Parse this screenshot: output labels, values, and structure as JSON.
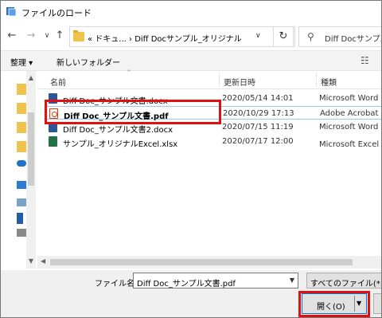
{
  "window": {
    "title": "ファイルのロード"
  },
  "nav": {
    "address_crumbs": "« ドキュ...  ›  Diff Docサンプル_オリジナル",
    "search_placeholder": "Diff Docサンプル"
  },
  "toolbar": {
    "organize": "整理 ▾",
    "new_folder": "新しいフォルダー"
  },
  "columns": {
    "name": "名前",
    "date": "更新日時",
    "type": "種類"
  },
  "files": [
    {
      "name": "Diff Doc_サンプル文書.docx",
      "date": "2020/05/14 14:01",
      "type": "Microsoft Word ...",
      "icon": "word-icon"
    },
    {
      "name": "Diff Doc_サンプル文書.pdf",
      "date": "2020/10/29 17:13",
      "type": "Adobe Acrobat D",
      "icon": "pdf-icon"
    },
    {
      "name": "Diff Doc_サンプル文書2.docx",
      "date": "2020/07/15 11:19",
      "type": "Microsoft Word ...",
      "icon": "word-icon"
    },
    {
      "name": "サンプル_オリジナルExcel.xlsx",
      "date": "2020/07/17 12:00",
      "type": "Microsoft Excel ワ",
      "icon": "excel-icon"
    }
  ],
  "footer": {
    "filename_label": "ファイル名(N):",
    "filename_value": "Diff Doc_サンプル文書.pdf",
    "filetype_value": "すべてのファイル(*.*)",
    "open_label": "開く(O)"
  },
  "colors": {
    "highlight": "#e01010",
    "selection_border": "#99c9ef",
    "accent": "#0078d7"
  }
}
